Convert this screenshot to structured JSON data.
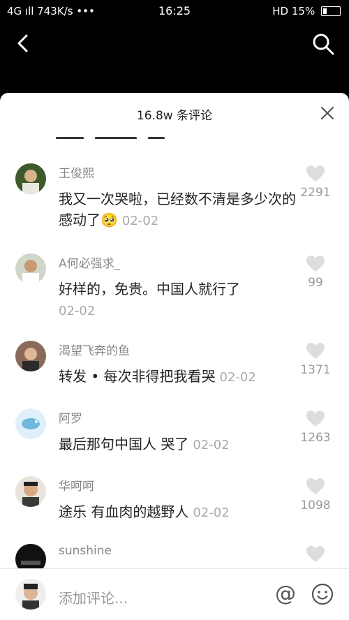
{
  "status": {
    "left": "4G ıll  743K/s •••",
    "time": "16:25",
    "right": "HD  15%"
  },
  "sheet": {
    "title": "16.8w 条评论"
  },
  "comments": [
    {
      "user": "王俊熙",
      "text": "我又一次哭啦，已经数不清是多少次的感动了",
      "emoji": "🥺",
      "date": "02-02",
      "likes": "2291"
    },
    {
      "user": "A何必强求_",
      "text": "好样的，免贵。中国人就行了",
      "date": "02-02",
      "likes": "99"
    },
    {
      "user": "渴望飞奔的鱼",
      "text": "转发 • 每次非得把我看哭",
      "date": "02-02",
      "likes": "1371"
    },
    {
      "user": "阿罗",
      "text": "最后那句中国人 哭了",
      "date": "02-02",
      "likes": "1263"
    },
    {
      "user": "华呵呵",
      "text": "途乐 有血肉的越野人",
      "date": "02-02",
      "likes": "1098"
    },
    {
      "user": "sunshine",
      "text": "",
      "date": "",
      "likes": ""
    }
  ],
  "composer": {
    "placeholder": "添加评论...",
    "at_symbol": "@"
  },
  "icons": {
    "back": "back-arrow-icon",
    "search": "search-icon",
    "close": "close-icon",
    "like": "heart-icon",
    "emoji": "emoji-icon"
  }
}
